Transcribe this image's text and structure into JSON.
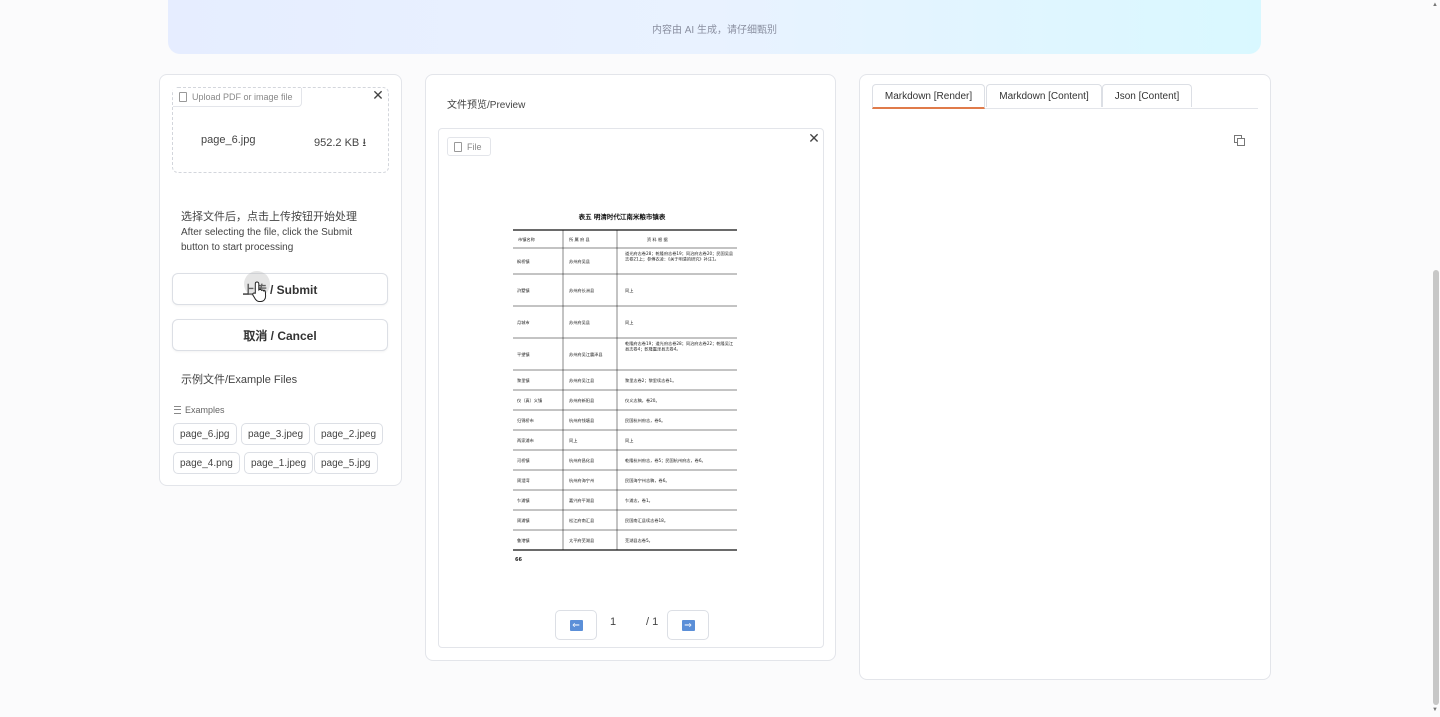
{
  "banner": {
    "note": "内容由 AI 生成，请仔细甄别"
  },
  "upload": {
    "tag_label": "Upload PDF or image file",
    "file_name": "page_6.jpg",
    "file_size": "952.2 KB",
    "download_glyph": "⭳"
  },
  "instructions": {
    "zh": "选择文件后，点击上传按钮开始处理",
    "en": "After selecting the file, click the Submit button to start processing"
  },
  "buttons": {
    "submit": "上传 / Submit",
    "cancel": "取消 / Cancel"
  },
  "examples": {
    "title": "示例文件/Example Files",
    "label": "Examples",
    "items": [
      "page_6.jpg",
      "page_3.jpeg",
      "page_2.jpeg",
      "page_4.png",
      "page_1.jpeg",
      "page_5.jpg"
    ]
  },
  "preview": {
    "title": "文件预览/Preview",
    "tag_label": "File",
    "page_current": "1",
    "page_total": "/ 1",
    "document": {
      "heading": "表五  明清时代江南米粮市镇表",
      "columns": [
        "市镇名称",
        "所 属 府 县",
        "资    料    根    据"
      ],
      "rows": [
        [
          "枫桥镇",
          "苏州府吴县",
          "道光府志卷28；乾隆府志卷19；同治府志卷20；民国吴县志卷21上；参傅衣凌：《关于明清的研究》补注1。"
        ],
        [
          "浒墅镇",
          "苏州府长洲县",
          "同上"
        ],
        [
          "月城市",
          "苏州府吴县",
          "同上"
        ],
        [
          "平望镇",
          "苏州府吴江震泽县",
          "乾隆府志卷19；道光府志卷28；同治府志卷22；乾隆吴江县志卷4；乾隆震泽县志卷4。"
        ],
        [
          "黎里镇",
          "苏州府吴江县",
          "黎里志卷2；黎里续志卷1。"
        ],
        [
          "仪（真）义镇",
          "苏州府新阳县",
          "仪义志稿，卷20。"
        ],
        [
          "归锦桥市",
          "杭州府钱塘县",
          "民国杭州府志，卷6。"
        ],
        [
          "两家浦市",
          "同上",
          "同上"
        ],
        [
          "河桥镇",
          "杭州府昌化县",
          "乾隆杭州府志，卷5；民国杭州府志，卷6。"
        ],
        [
          "周澄湾",
          "杭州府海宁州",
          "民国海宁州志稿，卷6。"
        ],
        [
          "乍浦镇",
          "嘉兴府平湖县",
          "乍浦志，卷1。"
        ],
        [
          "周浦镇",
          "松江府南汇县",
          "民国南汇县续志卷18。"
        ],
        [
          "鲁港镇",
          "太平府芜湖县",
          "芜湖县志卷5。"
        ]
      ],
      "page_number": "66"
    }
  },
  "output": {
    "tabs": [
      "Markdown [Render]",
      "Markdown [Content]",
      "Json [Content]"
    ]
  },
  "colors": {
    "tab_accent": "#e07b4a",
    "banner_start": "#e6edff",
    "banner_end": "#d9f8ff",
    "pager_arrow": "#5b8fd8"
  }
}
